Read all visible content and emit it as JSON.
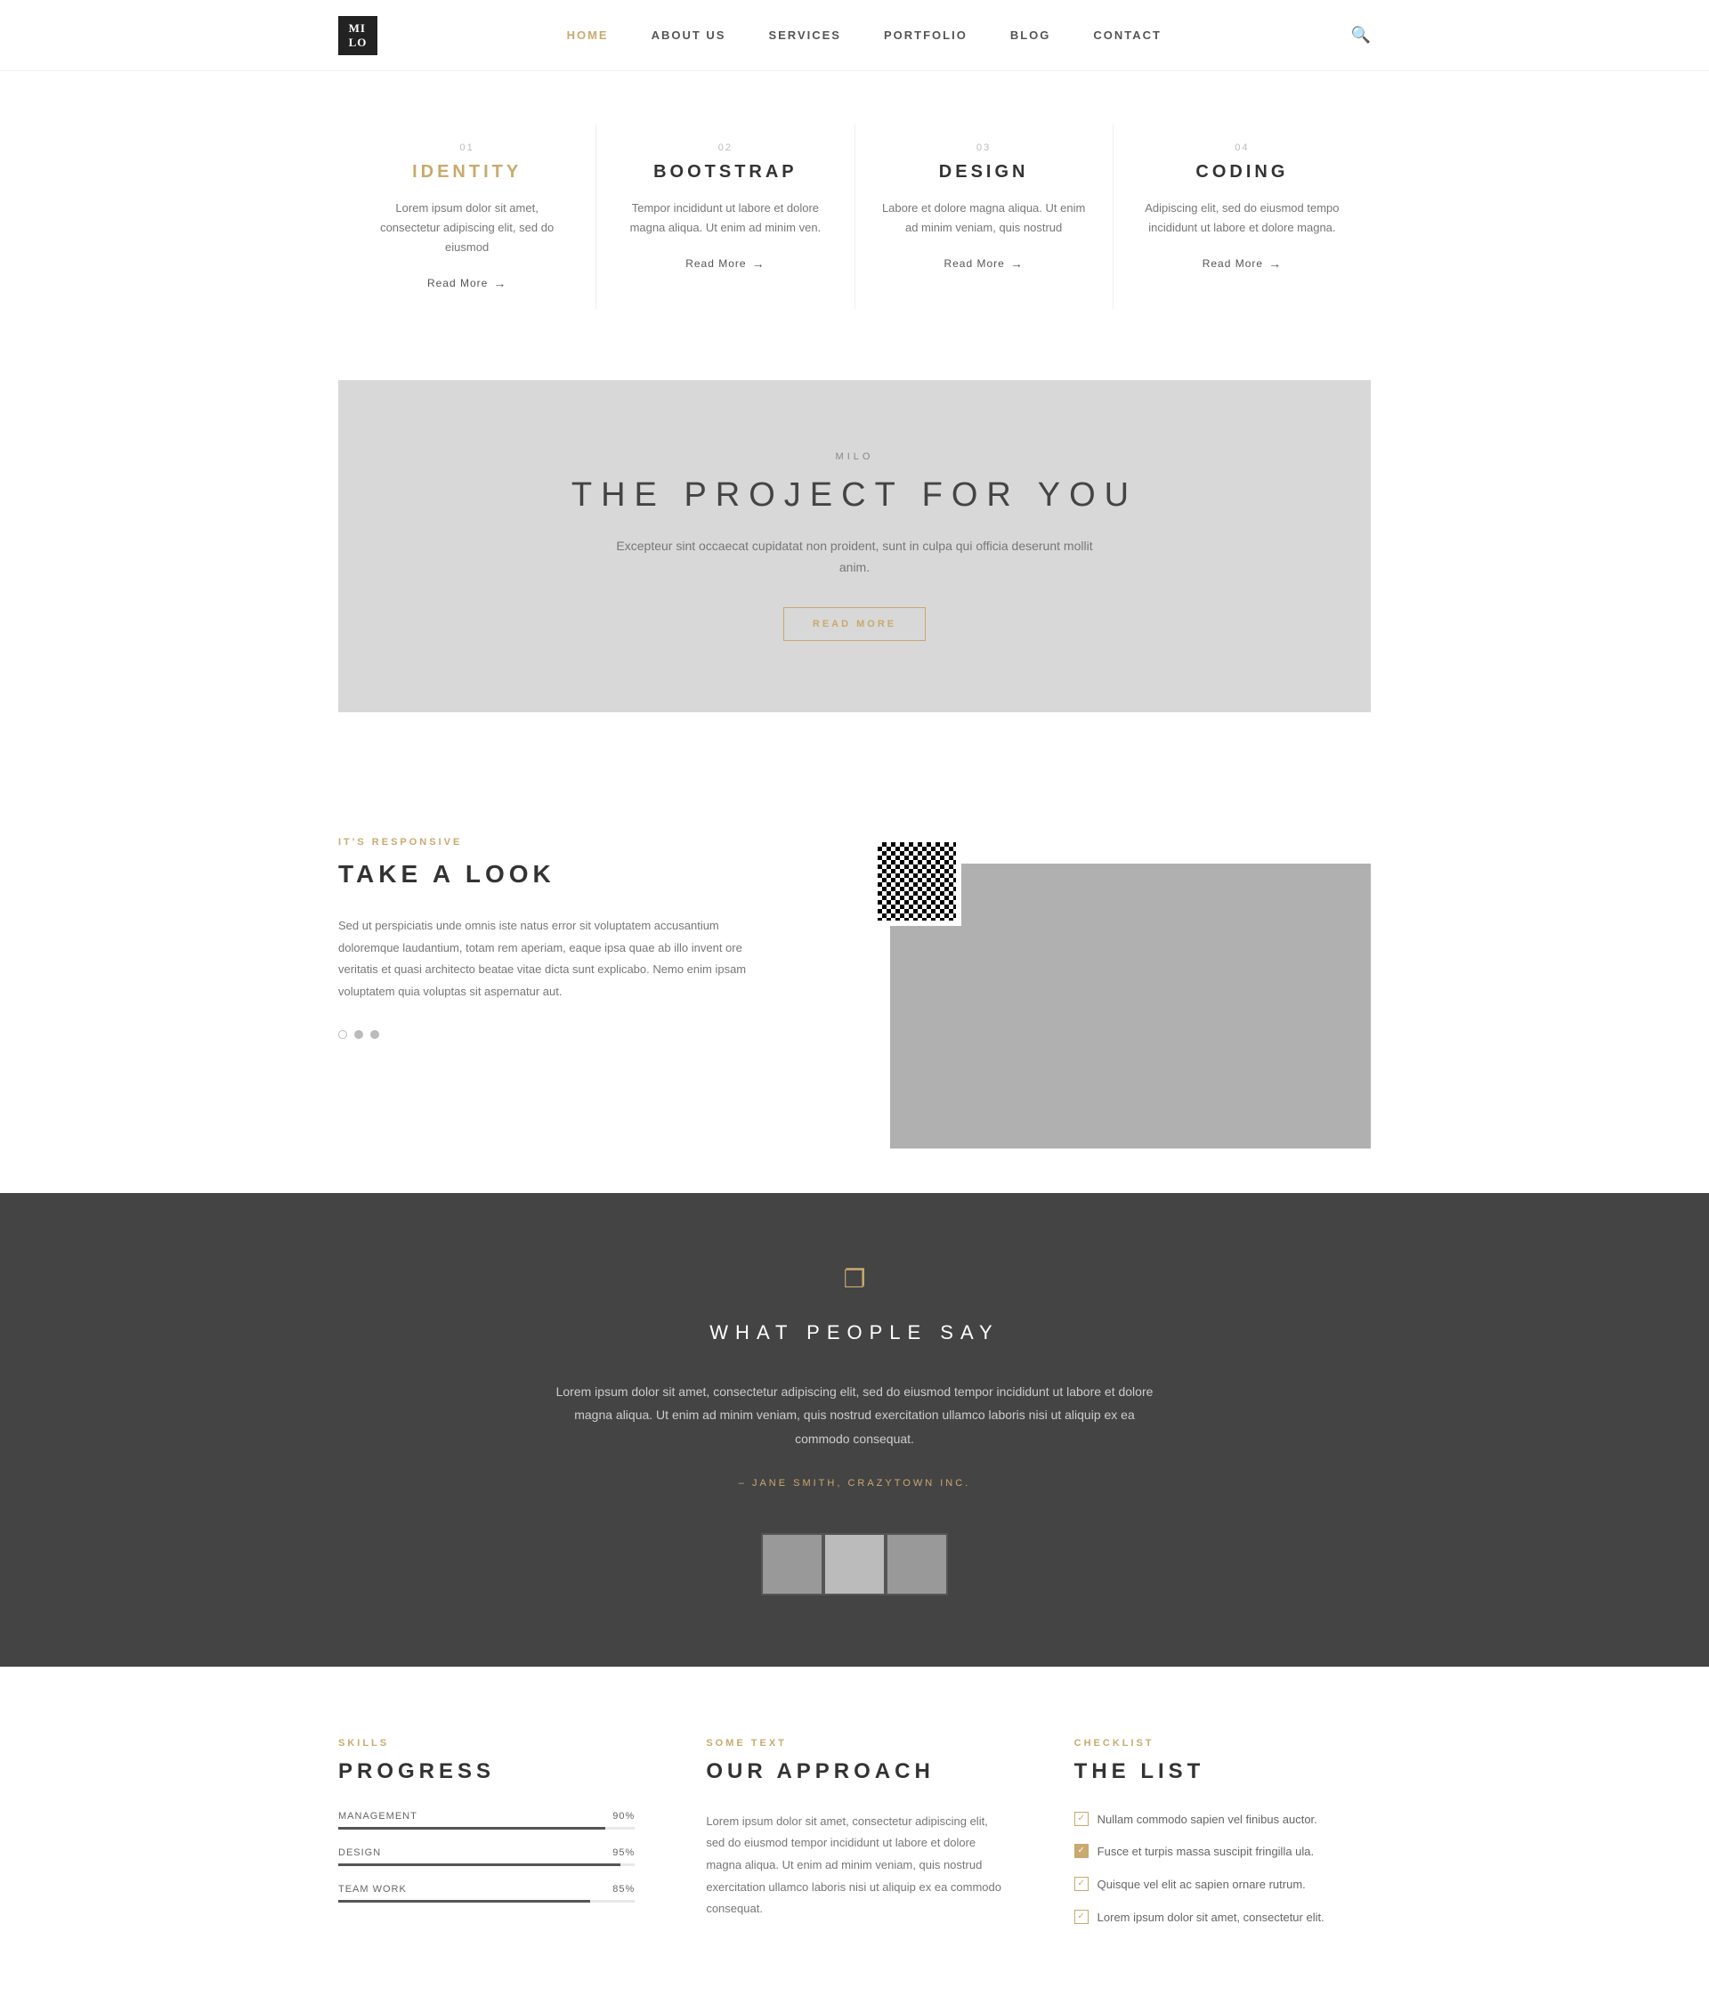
{
  "nav": {
    "logo_line1": "MI",
    "logo_line2": "LO",
    "links": [
      {
        "label": "HOME",
        "active": true
      },
      {
        "label": "ABOUT US",
        "active": false
      },
      {
        "label": "SERVICES",
        "active": false
      },
      {
        "label": "PORTFOLIO",
        "active": false
      },
      {
        "label": "BLOG",
        "active": false
      },
      {
        "label": "CONTACT",
        "active": false
      }
    ]
  },
  "services": [
    {
      "num": "01",
      "title": "IDENTITY",
      "gold": true,
      "desc": "Lorem ipsum dolor sit amet, consectetur adipiscing elit, sed do eiusmod",
      "read_more": "Read More"
    },
    {
      "num": "02",
      "title": "BOOTSTRAP",
      "gold": false,
      "desc": "Tempor incididunt ut labore et dolore magna aliqua. Ut enim ad minim ven.",
      "read_more": "Read More"
    },
    {
      "num": "03",
      "title": "DESIGN",
      "gold": false,
      "desc": "Labore et dolore magna aliqua. Ut enim ad minim veniam, quis nostrud",
      "read_more": "Read More"
    },
    {
      "num": "04",
      "title": "CODING",
      "gold": false,
      "desc": "Adipiscing elit, sed do eiusmod tempo incididunt ut labore et dolore magna.",
      "read_more": "Read More"
    }
  ],
  "banner": {
    "brand": "MILO",
    "title": "THE PROJECT FOR YOU",
    "desc": "Excepteur sint occaecat cupidatat non proident, sunt in culpa qui officia deserunt mollit anim.",
    "btn": "READ MORE"
  },
  "look_section": {
    "label": "IT'S RESPONSIVE",
    "title": "TAKE A LOOK",
    "desc": "Sed ut perspiciatis unde omnis iste natus error sit voluptatem accusantium doloremque laudantium, totam rem aperiam, eaque ipsa quae ab illo invent ore veritatis et quasi architecto beatae vitae dicta sunt explicabo. Nemo enim ipsam voluptatem quia voluptas sit aspernatur aut."
  },
  "testimonial": {
    "title": "WHAT PEOPLE SAY",
    "text": "Lorem ipsum dolor sit amet, consectetur adipiscing elit, sed do eiusmod tempor incididunt ut labore et dolore magna aliqua. Ut enim ad minim veniam, quis nostrud exercitation ullamco laboris nisi ut aliquip ex ea commodo consequat.",
    "author": "– JANE SMITH, CRAZYTOWN INC."
  },
  "skills": {
    "label": "SKILLS",
    "title": "PROGRESS",
    "items": [
      {
        "name": "MANAGEMENT",
        "value": 90,
        "display": "90%"
      },
      {
        "name": "DESIGN",
        "value": 95,
        "display": "95%"
      },
      {
        "name": "TEAM WORK",
        "value": 85,
        "display": "85%"
      }
    ]
  },
  "approach": {
    "label": "SOME TEXT",
    "title": "OUR APPROACH",
    "text": "Lorem ipsum dolor sit amet, consectetur adipiscing elit, sed do eiusmod tempor incididunt ut labore et dolore magna aliqua. Ut enim ad minim veniam, quis nostrud exercitation ullamco laboris nisi ut aliquip ex ea commodo consequat."
  },
  "checklist": {
    "label": "CHECKLIST",
    "title": "THE LIST",
    "items": [
      {
        "text": "Nullam commodo sapien vel finibus auctor.",
        "filled": false
      },
      {
        "text": "Fusce et turpis massa suscipit fringilla ula.",
        "filled": true
      },
      {
        "text": "Quisque vel elit ac sapien ornare rutrum.",
        "filled": false
      },
      {
        "text": "Lorem ipsum dolor sit amet, consectetur elit.",
        "filled": false
      }
    ]
  }
}
